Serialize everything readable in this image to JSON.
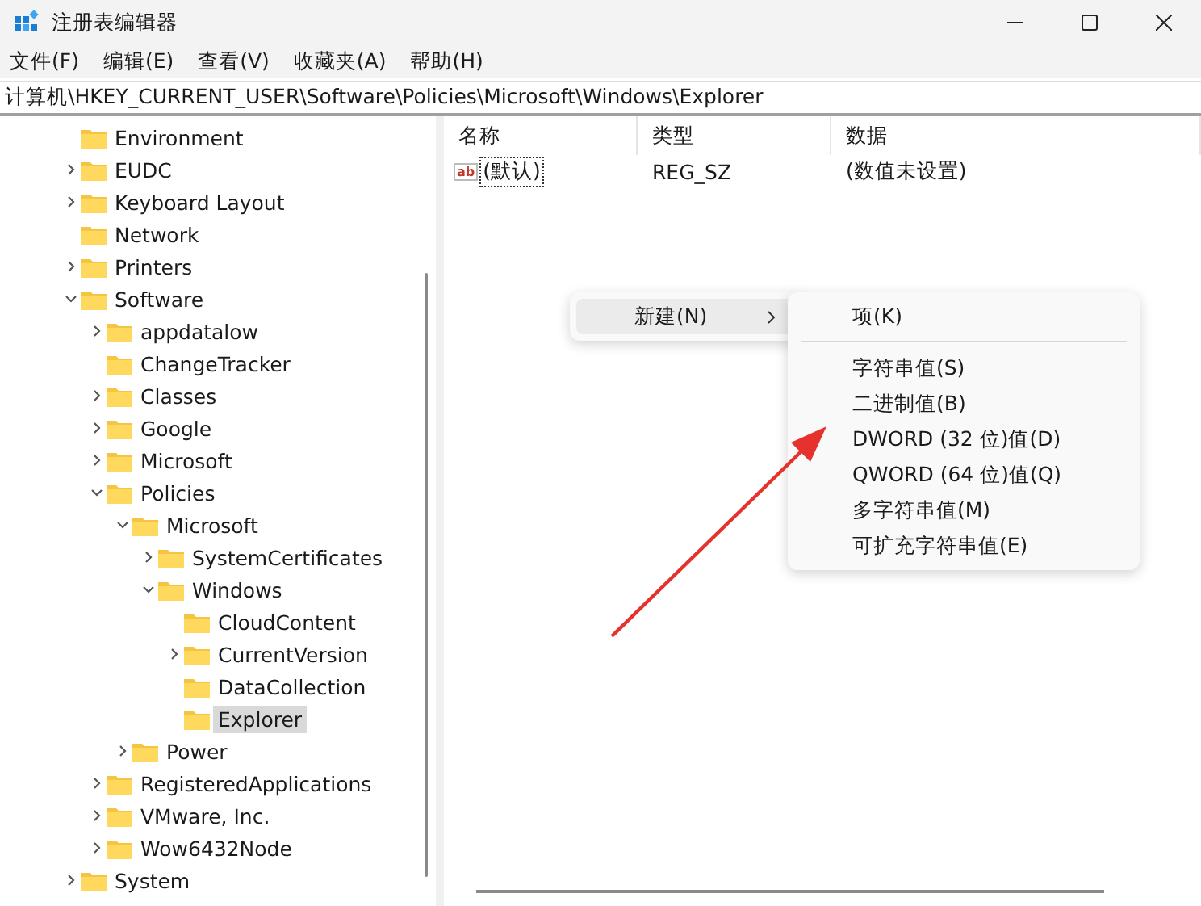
{
  "window": {
    "title": "注册表编辑器"
  },
  "menu": [
    "文件(F)",
    "编辑(E)",
    "查看(V)",
    "收藏夹(A)",
    "帮助(H)"
  ],
  "address": "计算机\\HKEY_CURRENT_USER\\Software\\Policies\\Microsoft\\Windows\\Explorer",
  "tree": [
    {
      "kind": "leaf",
      "label": "Environment",
      "selected": false
    },
    {
      "kind": "branch",
      "label": "EUDC",
      "expanded": false,
      "selected": false
    },
    {
      "kind": "branch",
      "label": "Keyboard Layout",
      "expanded": false,
      "selected": false
    },
    {
      "kind": "leaf",
      "label": "Network",
      "selected": false
    },
    {
      "kind": "branch",
      "label": "Printers",
      "expanded": false,
      "selected": false
    },
    {
      "kind": "branch",
      "label": "Software",
      "expanded": true,
      "selected": false,
      "children": [
        {
          "kind": "branch",
          "label": "appdatalow",
          "expanded": false,
          "selected": false
        },
        {
          "kind": "leaf",
          "label": "ChangeTracker",
          "selected": false
        },
        {
          "kind": "branch",
          "label": "Classes",
          "expanded": false,
          "selected": false
        },
        {
          "kind": "branch",
          "label": "Google",
          "expanded": false,
          "selected": false
        },
        {
          "kind": "branch",
          "label": "Microsoft",
          "expanded": false,
          "selected": false
        },
        {
          "kind": "branch",
          "label": "Policies",
          "expanded": true,
          "selected": false,
          "children": [
            {
              "kind": "branch",
              "label": "Microsoft",
              "expanded": true,
              "selected": false,
              "children": [
                {
                  "kind": "branch",
                  "label": "SystemCertificates",
                  "expanded": false,
                  "selected": false
                },
                {
                  "kind": "branch",
                  "label": "Windows",
                  "expanded": true,
                  "selected": false,
                  "children": [
                    {
                      "kind": "leaf",
                      "label": "CloudContent",
                      "selected": false
                    },
                    {
                      "kind": "branch",
                      "label": "CurrentVersion",
                      "expanded": false,
                      "selected": false
                    },
                    {
                      "kind": "leaf",
                      "label": "DataCollection",
                      "selected": false
                    },
                    {
                      "kind": "leaf",
                      "label": "Explorer",
                      "selected": true
                    }
                  ]
                }
              ]
            },
            {
              "kind": "branch",
              "label": "Power",
              "expanded": false,
              "selected": false
            }
          ]
        },
        {
          "kind": "branch",
          "label": "RegisteredApplications",
          "expanded": false,
          "selected": false
        },
        {
          "kind": "branch",
          "label": "VMware, Inc.",
          "expanded": false,
          "selected": false
        },
        {
          "kind": "branch",
          "label": "Wow6432Node",
          "expanded": false,
          "selected": false
        }
      ]
    },
    {
      "kind": "branch",
      "label": "System",
      "expanded": false,
      "selected": false
    }
  ],
  "table": {
    "columns": [
      "名称",
      "类型",
      "数据"
    ],
    "rows": [
      {
        "icon_text": "ab",
        "name": "(默认)",
        "type": "REG_SZ",
        "data": "(数值未设置)"
      }
    ]
  },
  "context_menu": {
    "items": [
      {
        "label": "新建(N)",
        "selected": true
      }
    ]
  },
  "submenu": {
    "items": [
      {
        "kind": "item",
        "label": "项(K)"
      },
      {
        "kind": "separator"
      },
      {
        "kind": "item",
        "label": "字符串值(S)"
      },
      {
        "kind": "item",
        "label": "二进制值(B)"
      },
      {
        "kind": "item",
        "label": "DWORD (32 位)值(D)"
      },
      {
        "kind": "item",
        "label": "QWORD (64 位)值(Q)"
      },
      {
        "kind": "item",
        "label": "多字符串值(M)"
      },
      {
        "kind": "item",
        "label": "可扩充字符串值(E)"
      }
    ]
  }
}
